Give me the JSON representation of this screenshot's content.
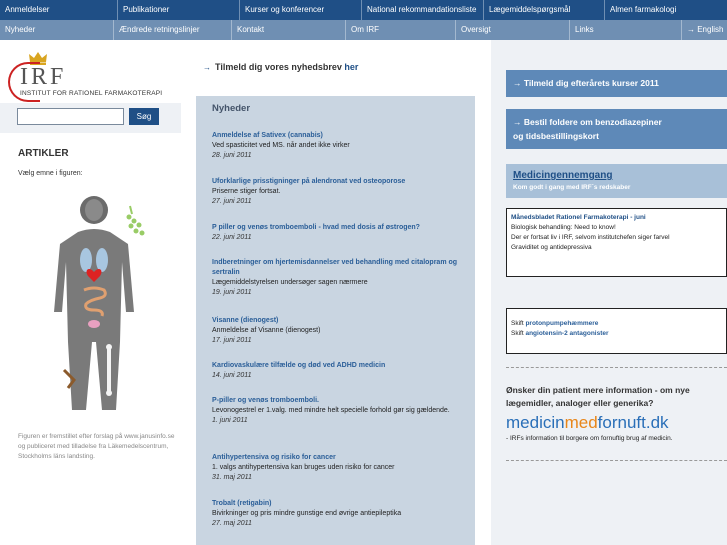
{
  "nav_primary": [
    "Anmeldelser",
    "Publikationer",
    "Kurser og konferencer",
    "National rekommandationsliste",
    "Lægemiddelspørgsmål",
    "Almen farmakologi"
  ],
  "nav_secondary": [
    "Nyheder",
    "Ændrede retningslinjer",
    "Kontakt",
    "Om IRF",
    "Oversigt",
    "Links",
    "→ English"
  ],
  "logo": {
    "short": "IRF",
    "full": "INSTITUT FOR RATIONEL FARMAKOTERAPI"
  },
  "search": {
    "value": "",
    "button": "Søg"
  },
  "articles": {
    "heading": "ARTIKLER",
    "choose": "Vælg emne i figuren:",
    "credit": "Figuren er fremstillet efter forslag på www.janusinfo.se og publiceret med tilladelse fra Läkemedelscentrum, Stockholms läns landsting."
  },
  "newsletter": {
    "arrow": "→",
    "text": "Tilmeld dig vores nyhedsbrev",
    "link": "her"
  },
  "news": {
    "heading": "Nyheder",
    "items": [
      {
        "title": "Anmeldelse af Sativex (cannabis)",
        "desc": "Ved spasticitet ved MS. når andet ikke virker",
        "date": "28. juni 2011"
      },
      {
        "title": "Uforklarlige prisstigninger på alendronat ved osteoporose",
        "desc": "Priserne stiger fortsat.",
        "date": "27. juni 2011"
      },
      {
        "title": "P piller og venøs tromboemboli - hvad med dosis af østrogen?",
        "desc": "",
        "date": "22. juni 2011"
      },
      {
        "title": "Indberetninger om hjertemisdannelser ved behandling med citalopram og sertralin",
        "desc": "Lægemiddelstyrelsen undersøger sagen nærmere",
        "date": "19. juni 2011"
      },
      {
        "title": "Visanne (dienogest)",
        "desc": "Anmeldelse af Visanne (dienogest)",
        "date": "17. juni 2011"
      },
      {
        "title": "Kardiovaskulære tilfælde og død ved ADHD medicin",
        "desc": "",
        "date": "14. juni 2011"
      },
      {
        "title": "P-piller og venøs tromboemboli.",
        "desc": "Levonogestrel er 1.valg. med mindre helt specielle forhold gør sig gældende.",
        "date": "1. juni 2011"
      },
      {
        "title": "Antihypertensiva og risiko for cancer",
        "desc": "1. valgs antihypertensiva kan bruges uden risiko for cancer",
        "date": "31. maj 2011"
      },
      {
        "title": "Trobalt (retigabin)",
        "desc": "Bivirkninger og pris mindre gunstige end øvrige antiepileptika",
        "date": "27. maj 2011"
      }
    ]
  },
  "right": {
    "btn_courses": "→ Tilmeld dig efterårets kurser 2011",
    "btn_folders_1": "→ Bestil foldere om benzodiazepiner",
    "btn_folders_2": "og tidsbestillingskort",
    "med_title": "Medicingennemgang",
    "med_sub": "Kom godt i gang med IRF´s redskaber",
    "monthly": {
      "title": "Månedsbladet Rationel Farmakoterapi",
      "issue": "- juni",
      "lines": [
        "Biologisk behandling: Need to know!",
        "Der er fortsat liv i IRF, selvom institutchefen siger farvel",
        "Graviditet og antidepressiva"
      ]
    },
    "switch": [
      {
        "prefix": "Skift ",
        "link": "protonpumpehæmmere"
      },
      {
        "prefix": "Skift ",
        "link": "angiotensin-2 antagonister"
      }
    ],
    "question": "Ønsker din patient mere information - om nye lægemidler, analoger eller generika?",
    "mfl_a": "medicin",
    "mfl_b": "med",
    "mfl_c": "fornuft.dk",
    "irfinfo": "- IRFs information til borgere om fornuftig brug af medicin."
  },
  "colors": {
    "nav_primary": "#1f4f86",
    "nav_secondary": "#6f8fb3",
    "news_bg": "#c9d5e1",
    "right_btn": "#5e89b8",
    "right_bg": "#eef1f5"
  },
  "icons": [
    "crown-logo-icon",
    "human-body-figure-icon"
  ]
}
